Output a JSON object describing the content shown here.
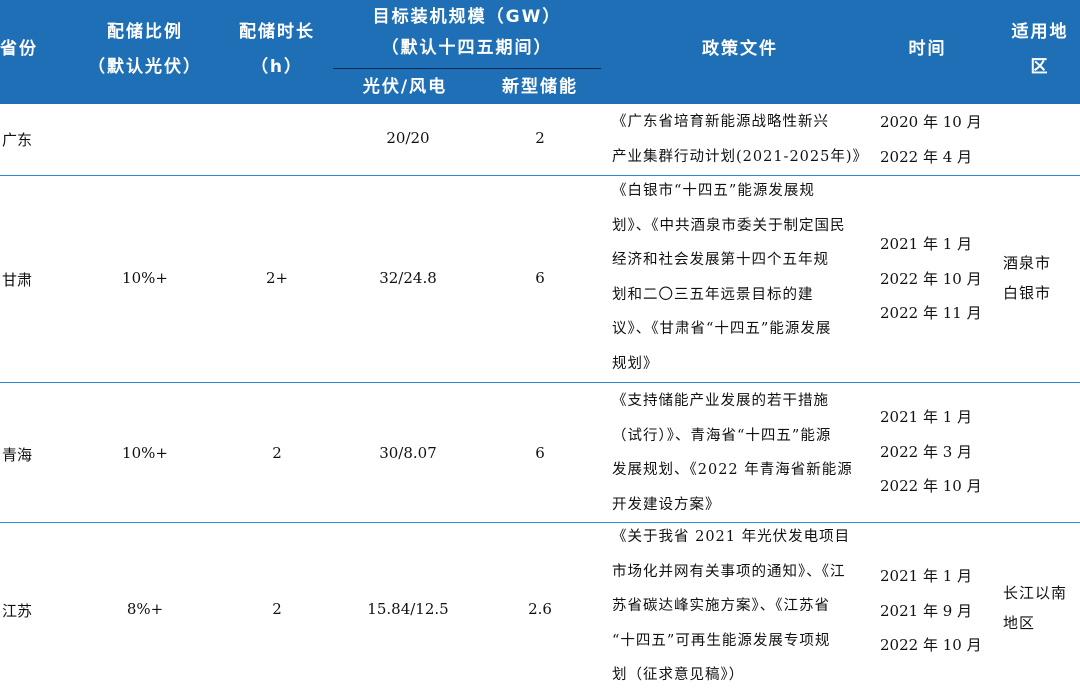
{
  "header": {
    "province": "省份",
    "ratio_line1": "配储比例",
    "ratio_line2": "（默认光伏）",
    "duration_line1": "配储时长",
    "duration_line2": "（h）",
    "target_line1": "目标装机规模（GW）",
    "target_line2": "（默认十四五期间）",
    "pv_wind": "光伏/风电",
    "storage": "新型储能",
    "policy": "政策文件",
    "time": "时间",
    "region_line1": "适用地",
    "region_line2": "区"
  },
  "rows": [
    {
      "province": "广东",
      "ratio": "",
      "duration": "",
      "pv_wind": "20/20",
      "storage": "2",
      "policy": [
        "《广东省培育新能源战略性新兴",
        "产业集群行动计划(2021-2025年)》"
      ],
      "times": [
        "2020 年 10 月",
        "2022 年 4 月"
      ],
      "regions": []
    },
    {
      "province": "甘肃",
      "ratio": "10%+",
      "duration": "2+",
      "pv_wind": "32/24.8",
      "storage": "6",
      "policy": [
        "《白银市“十四五”能源发展规",
        "划》、《中共酒泉市委关于制定国民",
        "经济和社会发展第十四个五年规",
        "划和二〇三五年远景目标的建",
        "议》、《甘肃省“十四五”能源发展",
        "规划》"
      ],
      "times": [
        "2021 年 1 月",
        "2022 年 10 月",
        "2022 年 11 月"
      ],
      "regions": [
        "酒泉市",
        "白银市"
      ]
    },
    {
      "province": "青海",
      "ratio": "10%+",
      "duration": "2",
      "pv_wind": "30/8.07",
      "storage": "6",
      "policy": [
        "《支持储能产业发展的若干措施",
        "（试行）》、青海省“十四五”能源",
        "发展规划、《2022 年青海省新能源",
        "开发建设方案》"
      ],
      "times": [
        "2021 年 1 月",
        "2022 年 3 月",
        "2022 年 10 月"
      ],
      "regions": []
    },
    {
      "province": "江苏",
      "ratio": "8%+",
      "duration": "2",
      "pv_wind": "15.84/12.5",
      "storage": "2.6",
      "policy": [
        "《关于我省 2021 年光伏发电项目",
        "市场化并网有关事项的通知》、《江",
        "苏省碳达峰实施方案》、《江苏省",
        "“十四五”可再生能源发展专项规",
        "划（征求意见稿》）"
      ],
      "times": [
        "2021 年 1 月",
        "2021 年 9 月",
        "2022 年 10 月"
      ],
      "regions": [
        "长江以南",
        "地区"
      ]
    }
  ]
}
